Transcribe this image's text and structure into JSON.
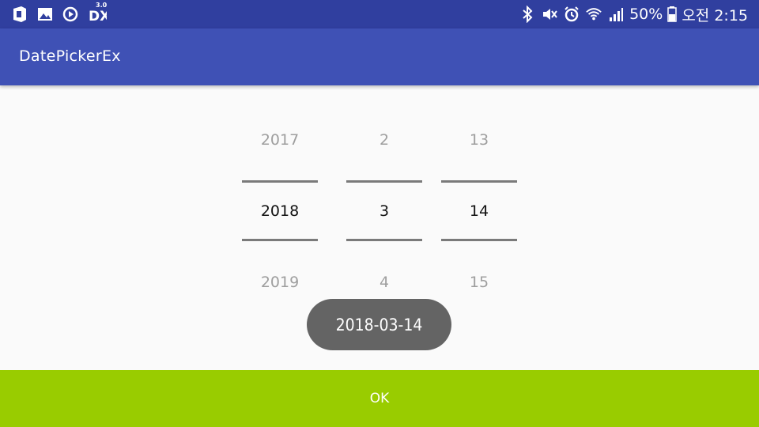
{
  "status_bar": {
    "left_icons": [
      "office-icon",
      "image-icon",
      "sync-icon",
      "dx-icon"
    ],
    "dx_badge": "3.0",
    "right_icons": [
      "bluetooth-icon",
      "mute-icon",
      "alarm-icon",
      "wifi-icon",
      "signal-icon"
    ],
    "battery_percent": "50%",
    "time": "오전 2:15"
  },
  "app_bar": {
    "title": "DatePickerEx"
  },
  "date_picker": {
    "year": {
      "prev": "2017",
      "current": "2018",
      "next": "2019"
    },
    "month": {
      "prev": "2",
      "current": "3",
      "next": "4"
    },
    "day": {
      "prev": "13",
      "current": "14",
      "next": "15"
    }
  },
  "toast": {
    "text": "2018-03-14"
  },
  "ok_button": {
    "label": "OK"
  },
  "colors": {
    "status_bar": "#303f9f",
    "app_bar": "#3f51b5",
    "ok_bar": "#99cc00",
    "toast": "#646464"
  }
}
